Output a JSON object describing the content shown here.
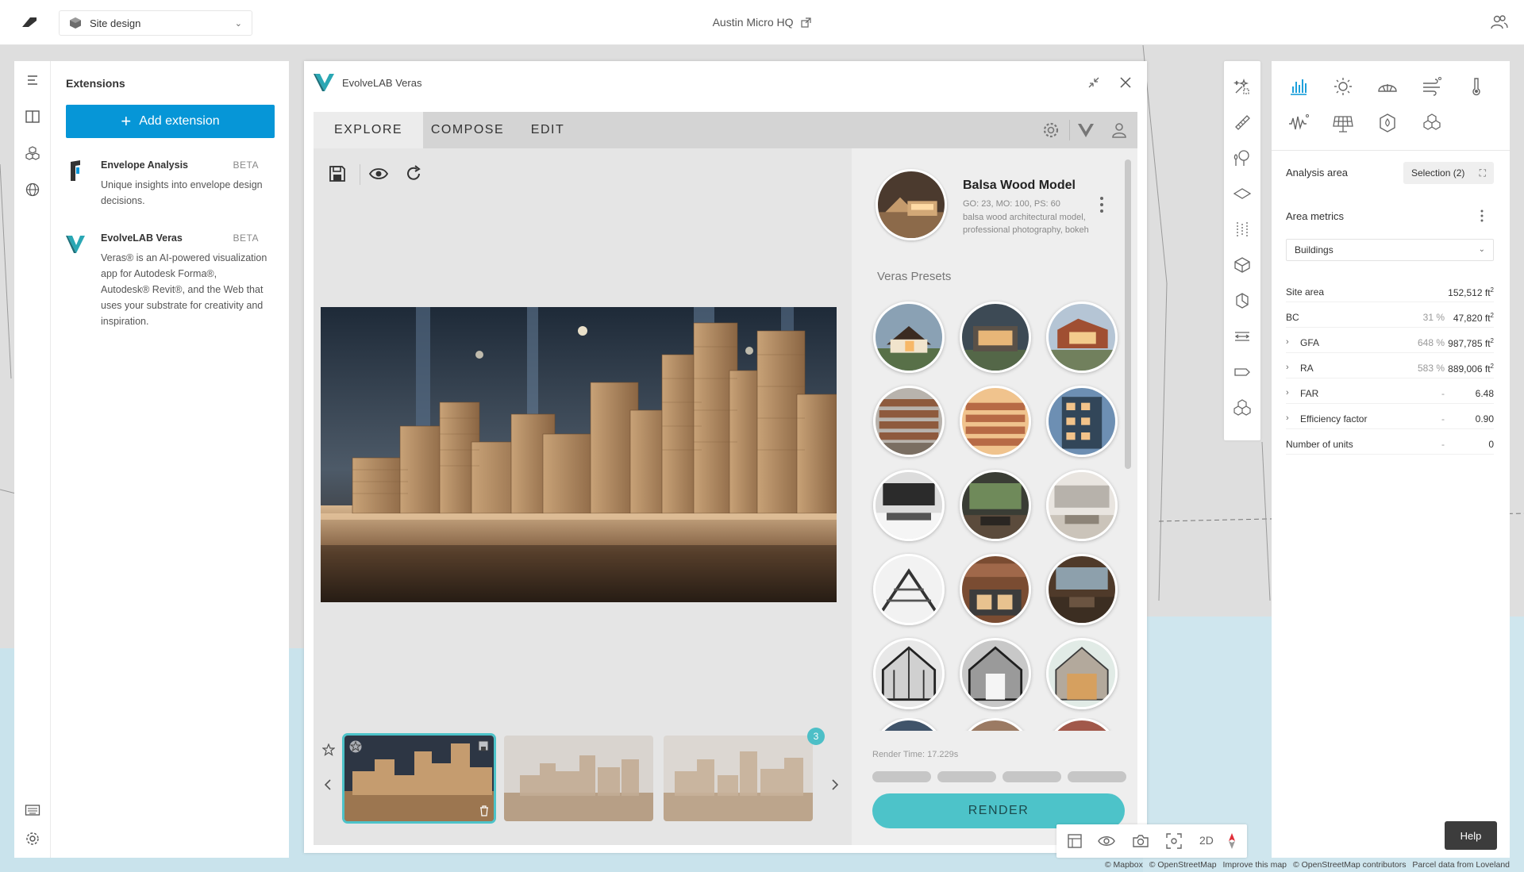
{
  "topbar": {
    "mode_label": "Site design",
    "project_title": "Austin Micro HQ",
    "icons": {
      "logo": "forma-logo-icon",
      "mode": "cube-icon",
      "chevron": "chevron-down-icon",
      "external": "external-link-icon",
      "collaborators": "people-icon"
    }
  },
  "left_rail": {
    "icons": [
      "menu-icon",
      "book-icon",
      "extensions-icon",
      "globe-icon",
      "keyboard-icon",
      "gear-icon"
    ]
  },
  "extensions": {
    "title": "Extensions",
    "add_button": "Add extension",
    "items": [
      {
        "name": "Envelope Analysis",
        "badge": "BETA",
        "description": "Unique insights into envelope design decisions."
      },
      {
        "name": "EvolveLAB Veras",
        "badge": "BETA",
        "description": "Veras® is an AI-powered visualization app for Autodesk Forma®, Autodesk® Revit®, and the Web that uses your substrate for creativity and inspiration."
      }
    ]
  },
  "veras": {
    "title": "EvolveLAB Veras",
    "tabs": [
      "EXPLORE",
      "COMPOSE",
      "EDIT"
    ],
    "active_tab": "EXPLORE",
    "tab_icons": [
      "settings-icon",
      "veras-logo-icon",
      "user-icon"
    ],
    "tools": [
      "save-icon",
      "eye-icon",
      "refresh-icon"
    ],
    "thumbnails_count": "3",
    "active_preset": {
      "name": "Balsa Wood Model",
      "params": "GO: 23, MO: 100, PS: 60",
      "prompt_line1": "balsa wood architectural model,",
      "prompt_line2": "professional photography, bokeh"
    },
    "presets_title": "Veras Presets",
    "render_time": "Render Time: 17.229s",
    "render_button": "RENDER"
  },
  "right_tools": {
    "icons": [
      "generate-icon",
      "draw-icon",
      "vegetation-icon",
      "layer-icon",
      "measure-icon",
      "building-icon",
      "box-icon",
      "align-icon",
      "tag-icon",
      "cubes-icon"
    ]
  },
  "analysis": {
    "icons": [
      "bar-chart-icon",
      "sun-icon",
      "daylight-icon",
      "wind-icon",
      "thermometer-icon",
      "noise-icon",
      "solar-panel-icon",
      "hexagon-icon",
      "blocks-icon"
    ],
    "area_label": "Analysis area",
    "selection": "Selection (2)",
    "metrics_label": "Area metrics",
    "dropdown_value": "Buildings",
    "rows": [
      {
        "label": "Site area",
        "pct": "",
        "value": "152,512 ft",
        "unit": "2",
        "expandable": false
      },
      {
        "label": "BC",
        "pct": "31 %",
        "value": "47,820 ft",
        "unit": "2",
        "expandable": false
      },
      {
        "label": "GFA",
        "pct": "648 %",
        "value": "987,785 ft",
        "unit": "2",
        "expandable": true
      },
      {
        "label": "RA",
        "pct": "583 %",
        "value": "889,006 ft",
        "unit": "2",
        "expandable": true
      },
      {
        "label": "FAR",
        "pct": "-",
        "value": "6.48",
        "unit": "",
        "expandable": true
      },
      {
        "label": "Efficiency factor",
        "pct": "-",
        "value": "0.90",
        "unit": "",
        "expandable": true
      },
      {
        "label": "Number of units",
        "pct": "-",
        "value": "0",
        "unit": "",
        "expandable": false
      }
    ],
    "help_button": "Help"
  },
  "bottom_tools": {
    "icons": [
      "map-icon",
      "eye-icon",
      "camera-icon",
      "focus-icon",
      "compass-icon"
    ],
    "view_mode": "2D"
  },
  "attribution": [
    "© Mapbox",
    "© OpenStreetMap",
    "Improve this map",
    "© OpenStreetMap contributors",
    "Parcel data from Loveland"
  ],
  "colors": {
    "accent_blue": "#0696d7",
    "veras_teal": "#4dc3c9",
    "water": "#c9e3ec"
  }
}
